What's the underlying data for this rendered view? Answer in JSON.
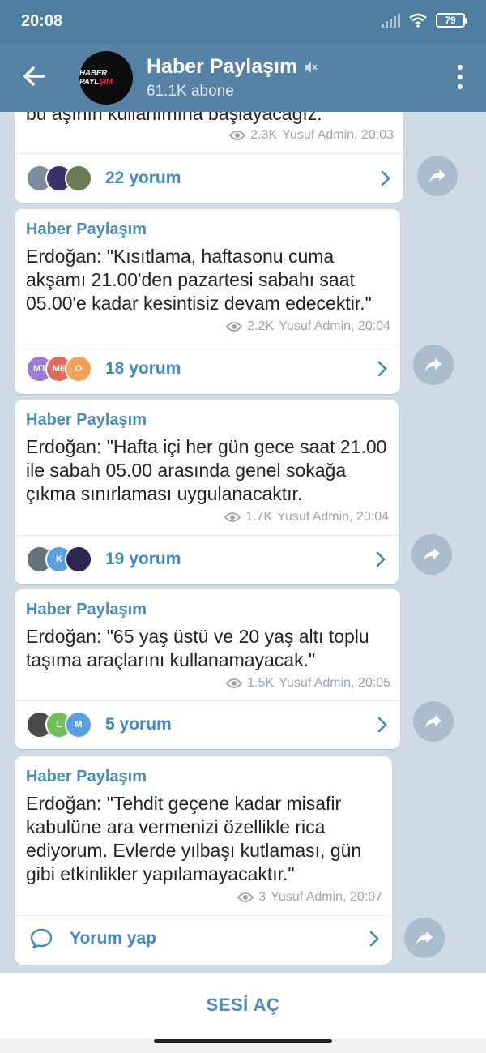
{
  "status_bar": {
    "time": "20:08",
    "battery": "79"
  },
  "header": {
    "title": "Haber Paylaşım",
    "subtitle": "61.1K abone",
    "avatar_text_1": "HABER PAYL",
    "avatar_text_2": "ŞIM",
    "muted_icon": "muted-speaker-icon"
  },
  "messages": [
    {
      "partial_text": "bu aşının kullanımına başlayacağız.",
      "views": "2.3K",
      "author_sig": "Yusuf Admin, 20:03",
      "comments": "22 yorum",
      "avatars": [
        {
          "label": "",
          "color": "#7c8da0"
        },
        {
          "label": "",
          "color": "#3b2f6e"
        },
        {
          "label": "",
          "color": "#6b7b56"
        }
      ]
    },
    {
      "author": "Haber Paylaşım",
      "text": "Erdoğan: \"Kısıtlama, haftasonu cuma akşamı 21.00'den pazartesi sabahı saat 05.00'e kadar kesintisiz devam edecektir.\"",
      "views": "2.2K",
      "author_sig": "Yusuf Admin, 20:04",
      "comments": "18 yorum",
      "avatars": [
        {
          "label": "MT",
          "color": "#9b7ad6"
        },
        {
          "label": "ME",
          "color": "#e36b5e"
        },
        {
          "label": "O",
          "color": "#f0a25a"
        }
      ]
    },
    {
      "author": "Haber Paylaşım",
      "text": "Erdoğan: \"Hafta içi her gün gece saat 21.00 ile sabah 05.00 arasında genel sokağa çıkma sınırlaması uygulanacaktır.",
      "views": "1.7K",
      "author_sig": "Yusuf Admin, 20:04",
      "comments": "19 yorum",
      "avatars": [
        {
          "label": "",
          "color": "#66727c"
        },
        {
          "label": "K",
          "color": "#5aa0e0"
        },
        {
          "label": "",
          "color": "#2e2450"
        }
      ]
    },
    {
      "author": "Haber Paylaşım",
      "text": "Erdoğan: \"65 yaş üstü ve 20 yaş altı toplu taşıma araçlarını kullanamayacak.\"",
      "views": "1.5K",
      "author_sig": "Yusuf Admin, 20:05",
      "comments": "5 yorum",
      "avatars": [
        {
          "label": "",
          "color": "#4a4a4a"
        },
        {
          "label": "L",
          "color": "#6fc25a"
        },
        {
          "label": "M",
          "color": "#5aa0e0"
        }
      ]
    },
    {
      "author": "Haber Paylaşım",
      "text": "Erdoğan: \"Tehdit geçene kadar misafir kabulüne ara vermenizi özellikle rica ediyorum. Evlerde yılbaşı kutlaması, gün gibi etkinlikler yapılamayacaktır.\"",
      "views": "3",
      "author_sig": "Yusuf Admin, 20:07",
      "comments": "Yorum yap"
    }
  ],
  "bottom": {
    "button": "SESİ AÇ"
  },
  "colors": {
    "header": "#5682a5",
    "accent": "#4a8bbb",
    "chat_bg": "#cfdbe4"
  }
}
